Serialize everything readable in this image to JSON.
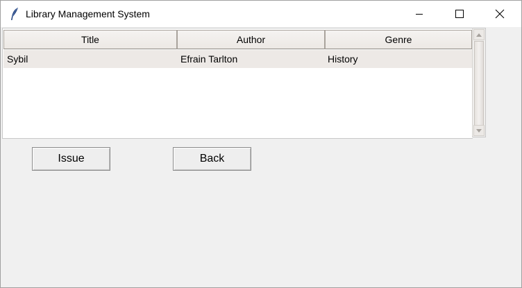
{
  "window": {
    "title": "Library Management System",
    "icon": "feather-icon"
  },
  "table": {
    "columns": [
      "Title",
      "Author",
      "Genre"
    ],
    "rows": [
      [
        "Sybil",
        "Efrain Tarlton",
        "History"
      ]
    ]
  },
  "buttons": {
    "issue": "Issue",
    "back": "Back"
  },
  "colors": {
    "selected_row": "#ede9e6",
    "background": "#f0f0f0"
  }
}
